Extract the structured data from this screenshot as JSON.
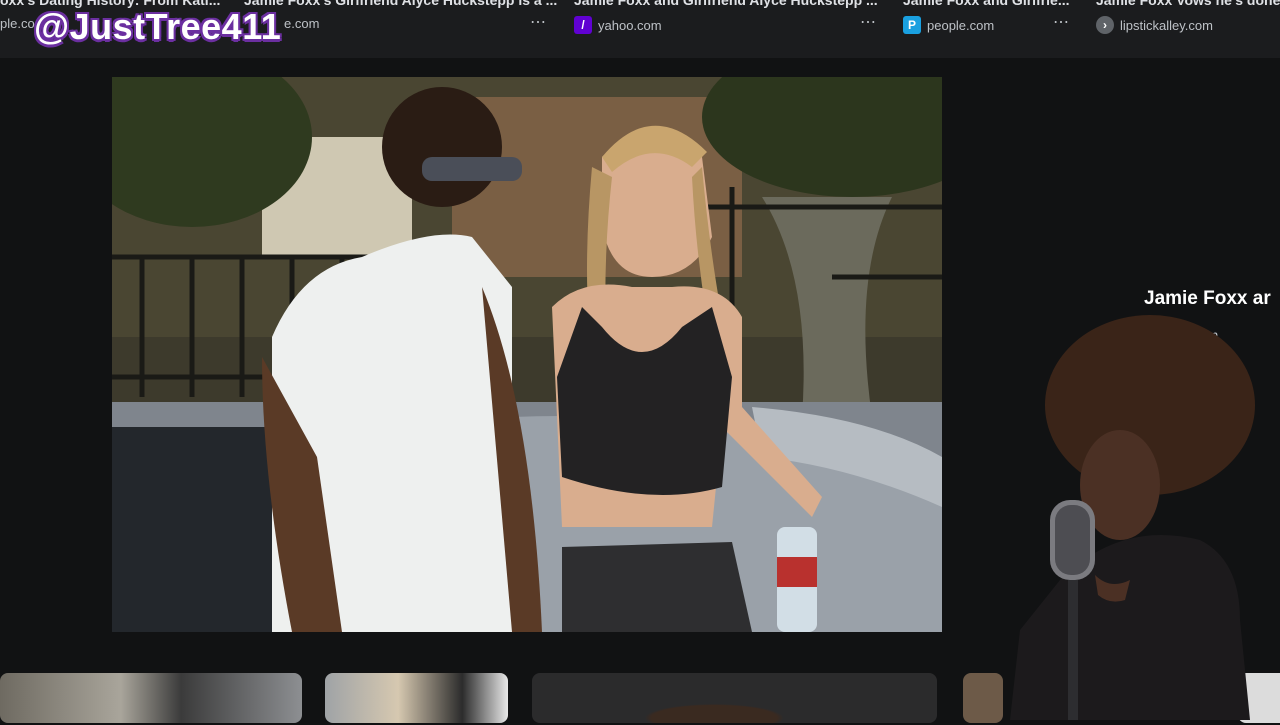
{
  "results": [
    {
      "title": "oxx's Dating History: From Kati...",
      "source": "ple.com"
    },
    {
      "title": "Jamie Foxx's Girlfriend Alyce Huckstepp is a ...",
      "source": "e.com"
    },
    {
      "title": "Jamie Foxx and Girlfriend Alyce Huckstepp ...",
      "source": "yahoo.com",
      "favicon": "yahoo-icon"
    },
    {
      "title": "Jamie Foxx and Girlfrie...",
      "source": "people.com",
      "favicon": "people-icon"
    },
    {
      "title": "Jamie Foxx Vows he's done ...",
      "source": "lipstickalley.com",
      "favicon": "lipstickalley-icon"
    }
  ],
  "menu_glyph": "⋯",
  "watermark": "@JustTree411",
  "side_panel": {
    "title": "Jamie Foxx ar",
    "source": ".com"
  },
  "colors": {
    "background": "#111213",
    "topbar": "#1b1c1e",
    "watermark_outline": "#6b2fa0"
  }
}
